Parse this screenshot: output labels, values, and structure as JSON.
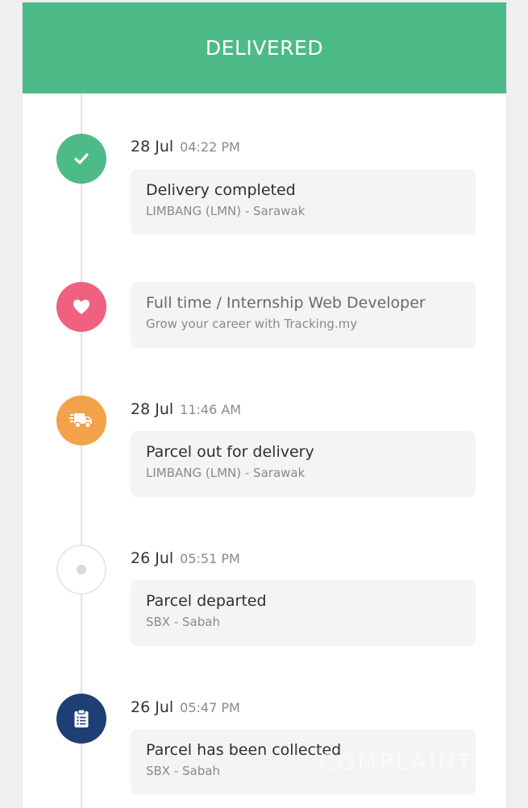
{
  "header": {
    "status": "DELIVERED",
    "color": "#4dbb87"
  },
  "events": [
    {
      "date": "28 Jul",
      "time": "04:22 PM",
      "title": "Delivery completed",
      "location": "LIMBANG (LMN) - Sarawak",
      "icon": "check-icon",
      "color": "#4dbb87"
    },
    {
      "title": "Full time / Internship Web Developer",
      "location": "Grow your career with Tracking.my",
      "icon": "heart-icon",
      "color": "#f0607f"
    },
    {
      "date": "28 Jul",
      "time": "11:46 AM",
      "title": "Parcel out for delivery",
      "location": "LIMBANG (LMN) - Sarawak",
      "icon": "delivery-truck-icon",
      "color": "#f4a24a"
    },
    {
      "date": "26 Jul",
      "time": "05:51 PM",
      "title": "Parcel departed",
      "location": "SBX - Sabah",
      "icon": "dot-icon",
      "color": "#d9d9d9"
    },
    {
      "date": "26 Jul",
      "time": "05:47 PM",
      "title": "Parcel has been collected",
      "location": "SBX - Sabah",
      "icon": "clipboard-icon",
      "color": "#1e3f73"
    }
  ],
  "watermark": "COMPLAINT BOARD"
}
